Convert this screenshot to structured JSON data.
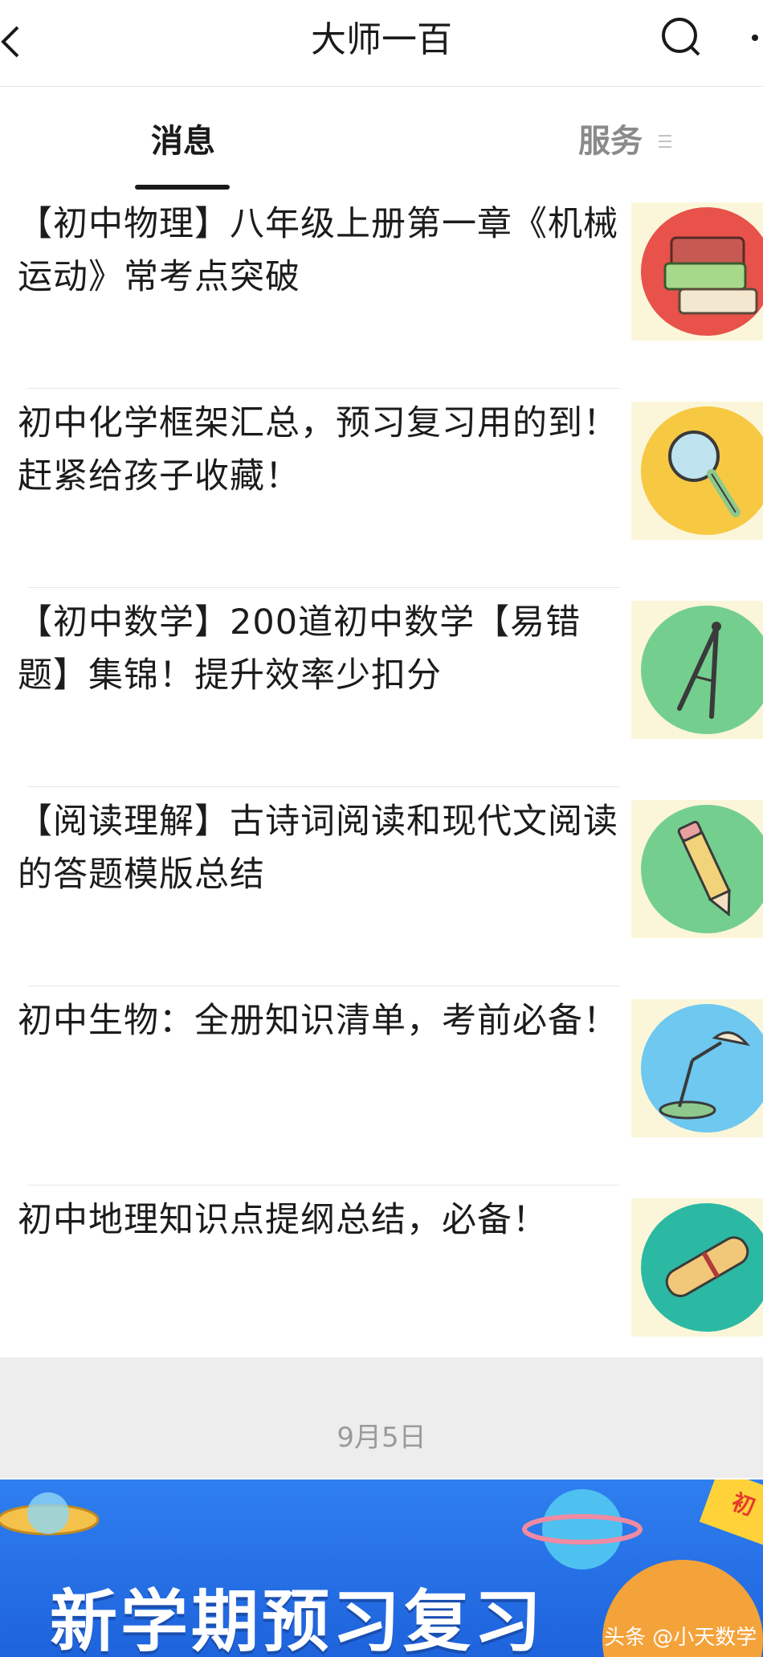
{
  "header": {
    "title": "大师一百"
  },
  "tabs": {
    "messages": "消息",
    "services": "服务"
  },
  "articles": [
    {
      "title": "【初中物理】八年级上册第一章《机械运动》常考点突破",
      "icon": "books-icon",
      "color": "#e8524a"
    },
    {
      "title": "初中化学框架汇总，预习复习用的到！赶紧给孩子收藏！",
      "icon": "magnifier-icon",
      "color": "#f7c842"
    },
    {
      "title": "【初中数学】200道初中数学【易错题】集锦！提升效率少扣分",
      "icon": "compass-icon",
      "color": "#74cf8f"
    },
    {
      "title": "【阅读理解】古诗词阅读和现代文阅读的答题模版总结",
      "icon": "pencil-icon",
      "color": "#74cf8f"
    },
    {
      "title": "初中生物：全册知识清单，考前必备！",
      "icon": "lamp-icon",
      "color": "#6ec8f0"
    },
    {
      "title": "初中地理知识点提纲总结，必备！",
      "icon": "scroll-icon",
      "color": "#2bb9a3"
    }
  ],
  "date": "9月5日",
  "banner": {
    "title": "新学期预习复习",
    "corner": "初",
    "watermark": "头条 @小天数学"
  }
}
